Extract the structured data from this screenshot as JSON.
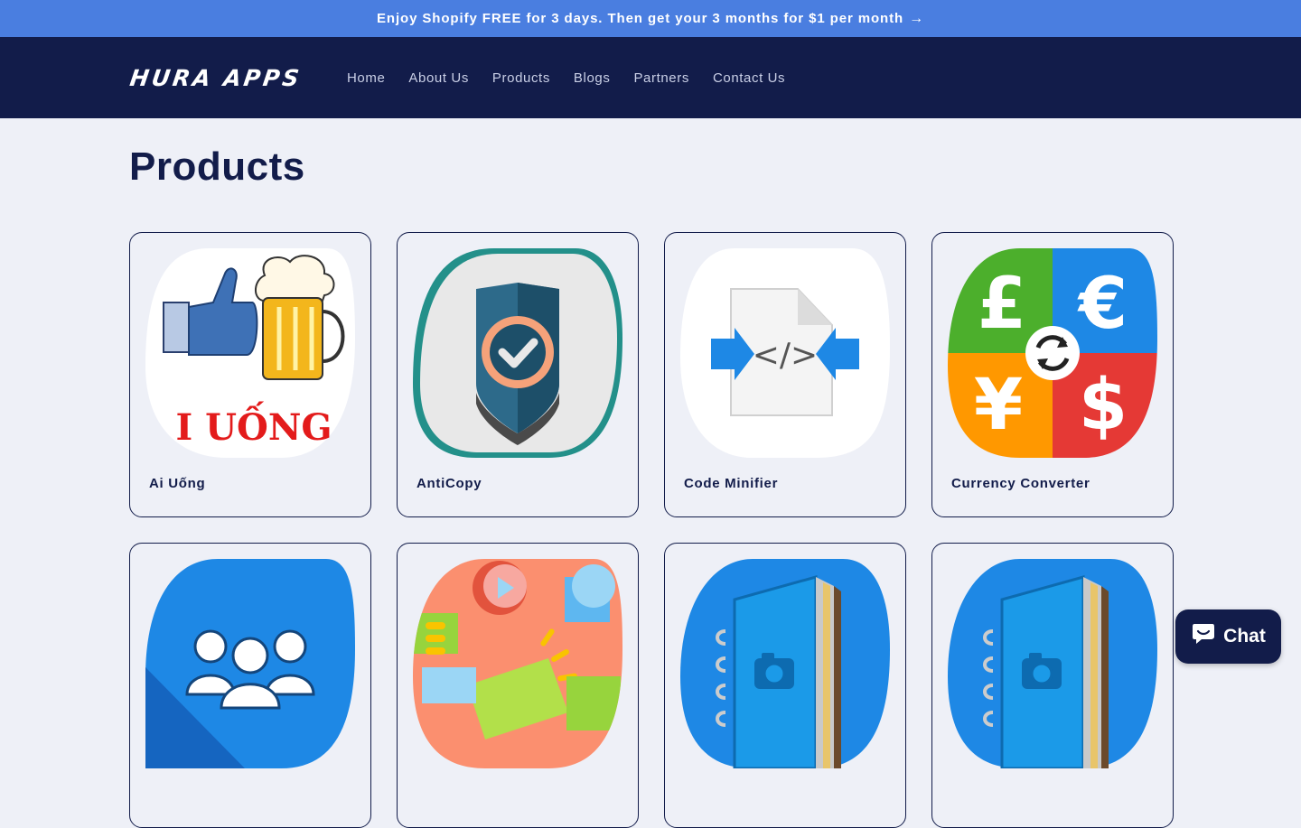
{
  "announcement": {
    "text": "Enjoy Shopify FREE for 3 days. Then get your 3 months for $1 per month",
    "arrow": "→"
  },
  "header": {
    "logo": "HURA APPS",
    "nav": [
      "Home",
      "About Us",
      "Products",
      "Blogs",
      "Partners",
      "Contact Us"
    ]
  },
  "page": {
    "title": "Products"
  },
  "products": [
    {
      "title": "Ai Uống",
      "icon": "beer-thumbs-up-icon"
    },
    {
      "title": "AntiCopy",
      "icon": "shield-check-icon"
    },
    {
      "title": "Code Minifier",
      "icon": "code-file-icon"
    },
    {
      "title": "Currency Converter",
      "icon": "currency-exchange-icon"
    },
    {
      "title": "",
      "icon": "group-users-icon"
    },
    {
      "title": "",
      "icon": "marketing-collage-icon"
    },
    {
      "title": "",
      "icon": "photo-album-icon"
    },
    {
      "title": "",
      "icon": "photo-album-icon"
    }
  ],
  "chat": {
    "label": "Chat",
    "icon": "chat-bubble-icon"
  },
  "colors": {
    "announcement_bg": "#4a7ee0",
    "header_bg": "#121c4a",
    "page_bg": "#eef0f7",
    "accent_text": "#121c4a"
  }
}
